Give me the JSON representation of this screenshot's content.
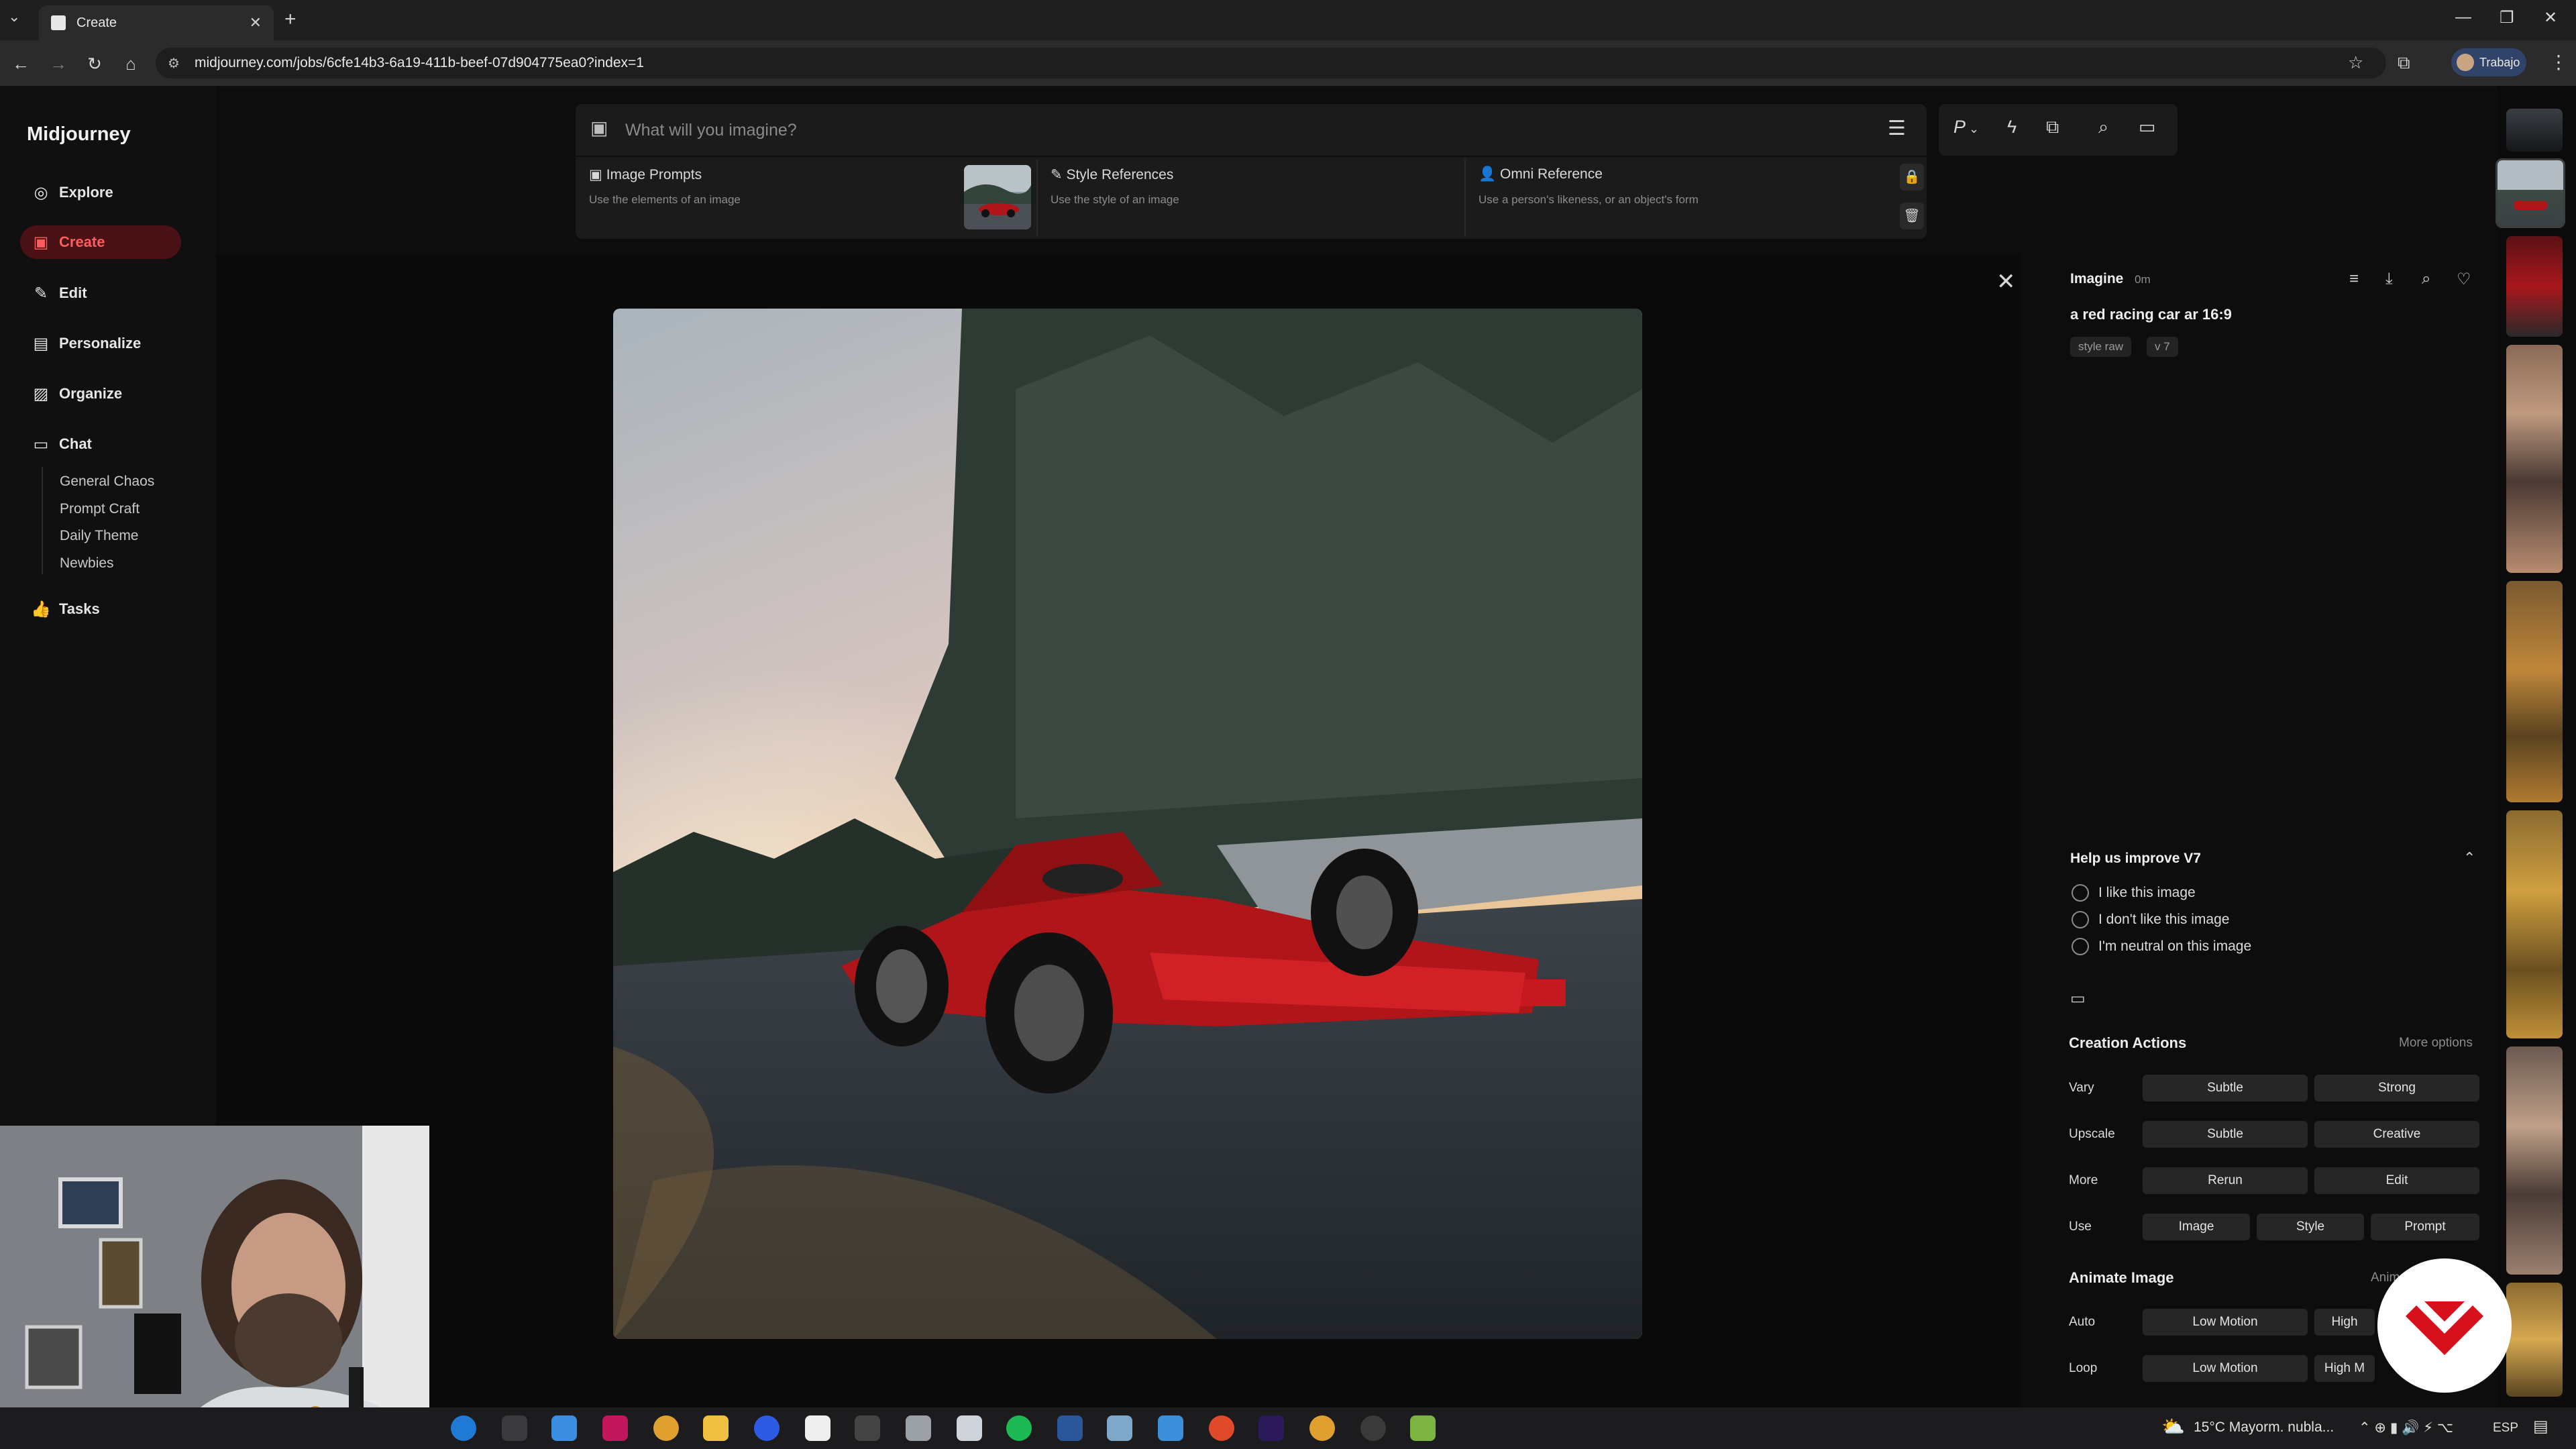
{
  "browser": {
    "tab_title": "Create",
    "tab_close": "✕",
    "new_tab": "+",
    "url": "midjourney.com/jobs/6cfe14b3-6a19-411b-beef-07d904775ea0?index=1",
    "profile_label": "Trabajo",
    "window_controls": [
      "—",
      "❐",
      "✕"
    ],
    "nav_icons": [
      "back-icon",
      "forward-icon",
      "reload-icon",
      "home-icon"
    ]
  },
  "sidebar": {
    "logo": "Midjourney",
    "items": [
      {
        "label": "Explore",
        "icon": "compass-icon"
      },
      {
        "label": "Create",
        "icon": "create-icon"
      },
      {
        "label": "Edit",
        "icon": "pencil-icon"
      },
      {
        "label": "Personalize",
        "icon": "personalize-icon"
      },
      {
        "label": "Organize",
        "icon": "image-icon"
      },
      {
        "label": "Chat",
        "icon": "chat-icon"
      },
      {
        "label": "Tasks",
        "icon": "thumbs-up-icon"
      }
    ],
    "channels": [
      "General Chaos",
      "Prompt Craft",
      "Daily Theme",
      "Newbies"
    ]
  },
  "prompt_bar": {
    "placeholder": "What will you imagine?",
    "references": [
      {
        "title": "Image Prompts",
        "subtitle": "Use the elements of an image"
      },
      {
        "title": "Style References",
        "subtitle": "Use the style of an image"
      },
      {
        "title": "Omni Reference",
        "subtitle": "Use a person's likeness, or an object's form"
      }
    ],
    "tools": [
      "personalize-p-icon",
      "lightning-icon",
      "chat-icon",
      "search-icon",
      "folder-icon"
    ]
  },
  "detail": {
    "title": "Imagine",
    "age": "0m",
    "prompt": "a red racing car ar 16:9",
    "chips": [
      "style raw",
      "v 7"
    ],
    "improve": {
      "title": "Help us improve V7",
      "options": [
        "I like this image",
        "I don't like this image",
        "I'm neutral on this image"
      ]
    },
    "creation_actions": {
      "title": "Creation Actions",
      "more": "More options",
      "rows": [
        {
          "label": "Vary",
          "buttons": [
            "Subtle",
            "Strong"
          ]
        },
        {
          "label": "Upscale",
          "buttons": [
            "Subtle",
            "Creative"
          ]
        },
        {
          "label": "More",
          "buttons": [
            "Rerun",
            "Edit"
          ]
        },
        {
          "label": "Use",
          "buttons": [
            "Image",
            "Style",
            "Prompt"
          ]
        }
      ]
    },
    "animate": {
      "title": "Animate Image",
      "side_label": "Anim",
      "rows": [
        {
          "label": "Auto",
          "buttons": [
            "Low Motion",
            "High"
          ]
        },
        {
          "label": "Loop",
          "buttons": [
            "Low Motion",
            "High M"
          ]
        }
      ]
    }
  },
  "taskbar": {
    "weather": "15°C  Mayorm. nubla...",
    "lang": "ESP"
  },
  "colors": {
    "accent": "#ff5d5d",
    "accent_bg": "#4a1216",
    "car_red": "#b0151a"
  }
}
